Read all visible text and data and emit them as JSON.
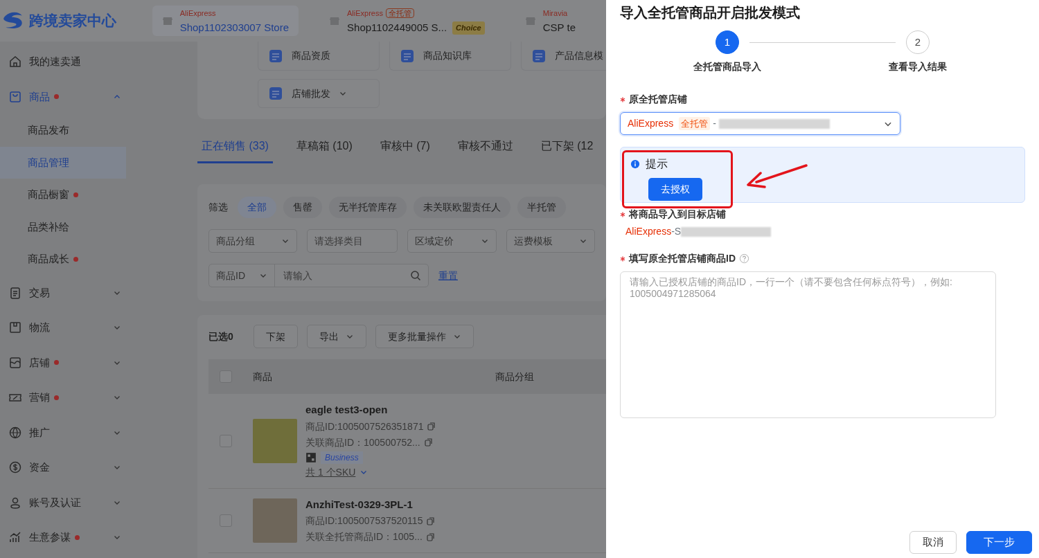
{
  "header": {
    "logo_text": "跨境卖家中心",
    "shops": [
      {
        "platform": "AliExpress",
        "name": "Shop1102303007 Store",
        "selected": true
      },
      {
        "platform": "AliExpress",
        "badge": "全托管",
        "name": "Shop1102449005 S...",
        "choice": "Choice",
        "selected": false
      },
      {
        "platform": "Miravia",
        "name": "CSP te",
        "selected": false
      }
    ]
  },
  "sidebar": {
    "items": [
      {
        "label": "我的速卖通",
        "dot": false
      },
      {
        "label": "商品",
        "dot": true,
        "expanded": true,
        "active": true,
        "children": [
          {
            "label": "商品发布",
            "dot": false,
            "selected": false
          },
          {
            "label": "商品管理",
            "dot": false,
            "selected": true
          },
          {
            "label": "商品橱窗",
            "dot": true,
            "selected": false
          },
          {
            "label": "品类补给",
            "dot": false,
            "selected": false
          },
          {
            "label": "商品成长",
            "dot": true,
            "selected": false
          }
        ]
      },
      {
        "label": "交易",
        "dot": false,
        "expanded": false
      },
      {
        "label": "物流",
        "dot": false,
        "expanded": false
      },
      {
        "label": "店铺",
        "dot": true,
        "expanded": false
      },
      {
        "label": "营销",
        "dot": true,
        "expanded": false
      },
      {
        "label": "推广",
        "dot": false,
        "expanded": false
      },
      {
        "label": "资金",
        "dot": false,
        "expanded": false
      },
      {
        "label": "账号及认证",
        "dot": false,
        "expanded": false
      },
      {
        "label": "生意参谋",
        "dot": true,
        "expanded": false
      }
    ]
  },
  "tools": [
    {
      "label": "商品资质"
    },
    {
      "label": "商品知识库"
    },
    {
      "label": "产品信息模"
    },
    {
      "label": "店铺批发",
      "menu": true
    }
  ],
  "tabs": [
    {
      "label": "正在销售 (33)",
      "selected": true
    },
    {
      "label": "草稿箱 (10)",
      "selected": false
    },
    {
      "label": "审核中 (7)",
      "selected": false
    },
    {
      "label": "审核不通过",
      "selected": false
    },
    {
      "label": "已下架 (12",
      "selected": false
    }
  ],
  "filter": {
    "label": "筛选",
    "chips": [
      {
        "label": "全部",
        "selected": true
      },
      {
        "label": "售罄",
        "selected": false
      },
      {
        "label": "无半托管库存",
        "selected": false
      },
      {
        "label": "未关联欧盟责任人",
        "selected": false
      },
      {
        "label": "半托管",
        "selected": false
      }
    ],
    "selects": [
      {
        "kind": "select",
        "text": "商品分组"
      },
      {
        "kind": "input",
        "placeholder": "请选择类目"
      },
      {
        "kind": "select",
        "text": "区域定价"
      },
      {
        "kind": "select",
        "text": "运费模板"
      }
    ]
  },
  "search": {
    "field": "商品ID",
    "placeholder": "请输入",
    "reset": "重置"
  },
  "bulk": {
    "count": "已选0",
    "buttons": [
      {
        "label": "下架",
        "menu": false
      },
      {
        "label": "导出",
        "menu": true
      },
      {
        "label": "更多批量操作",
        "menu": true
      }
    ]
  },
  "table": {
    "select_all": false,
    "columns": [
      "商品",
      "商品分组"
    ],
    "rows": [
      {
        "checked": false,
        "title": "eagle test3-open",
        "id_line": "商品ID:1005007526351871",
        "linked_line": "关联商品ID：100500752...",
        "tag": "Business",
        "sku": "共 1 个SKU"
      },
      {
        "checked": false,
        "title": "AnzhiTest-0329-3PL-1",
        "id_line": "商品ID:1005007537520115",
        "linked_line": "关联全托管商品ID：1005..."
      }
    ]
  },
  "drawer": {
    "title": "导入全托管商品开启批发模式",
    "steps": [
      {
        "number": "1",
        "label": "全托管商品导入",
        "selected": true
      },
      {
        "number": "2",
        "label": "查看导入结果",
        "selected": false
      }
    ],
    "source": {
      "label": "原全托管店铺",
      "platform": "AliExpress",
      "badge": "全托管",
      "separator": "-"
    },
    "alert": {
      "title": "提示",
      "button": "去授权"
    },
    "target": {
      "label": "将商品导入到目标店铺",
      "platform": "AliExpress",
      "prefix": "-S"
    },
    "ids": {
      "label": "填写原全托管店铺商品ID",
      "placeholder": "请输入已授权店铺的商品ID，一行一个（请不要包含任何标点符号），例如:\n1005004971285064"
    },
    "buttons": [
      {
        "label": "取消",
        "kind": "secondary"
      },
      {
        "label": "下一步",
        "kind": "primary"
      }
    ]
  }
}
